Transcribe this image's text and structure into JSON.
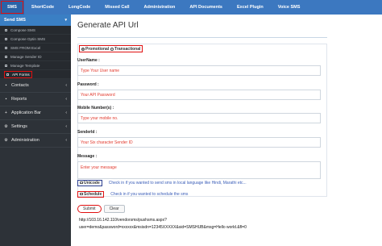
{
  "topnav": {
    "items": [
      "SMS",
      "ShortCode",
      "LongCode",
      "Missed Call",
      "Administration",
      "API Documents",
      "Excel Plugin",
      "Voice SMS"
    ]
  },
  "sidebar": {
    "section_title": "Send SMS",
    "section_arrow": "▾",
    "sub_items": [
      "Compose SMS",
      "Compose Optin SMS",
      "SMS FROM Excel",
      "Manage Sender ID",
      "Manage Template",
      "API Forms"
    ],
    "items": [
      {
        "label": "Contacts",
        "icon": "▪"
      },
      {
        "label": "Reports",
        "icon": "▪"
      },
      {
        "label": "Application Bar",
        "icon": "+"
      },
      {
        "label": "Settings",
        "icon": "⚙"
      },
      {
        "label": "Administration",
        "icon": "⚙"
      }
    ],
    "item_arrow": "‹"
  },
  "main": {
    "title": "Generate API Url",
    "type_promotional": "Promotional",
    "type_transactional": "Transactional",
    "username_label": "UserName :",
    "username_placeholder": "Type Your User name",
    "password_label": "Password :",
    "password_placeholder": "Your API Password",
    "mobile_label": "Mobile Number(s) :",
    "mobile_placeholder": "Type your mobile no.",
    "senderid_label": "SenderId :",
    "senderid_placeholder": "Your Six character Sender ID",
    "message_label": "Message :",
    "message_placeholder": "Enter your message",
    "unicode_label": "Unicode",
    "unicode_hint": "Check in if you wanted to send sms in local language like Hindi, Marathi etc...",
    "schedule_label": "Schedule",
    "schedule_hint": "Check in if you wanted to schedule the sms",
    "submit_label": "Submit",
    "clear_label": "Clear",
    "url_line1": "http://103.16.142.110/vendorsms/pushsms.aspx?",
    "url_line2": "user=demo&password=xxxxxx&msisdn=12345XXXXX&sid=SMSHUB&msg=Hello world.&fl=0"
  }
}
